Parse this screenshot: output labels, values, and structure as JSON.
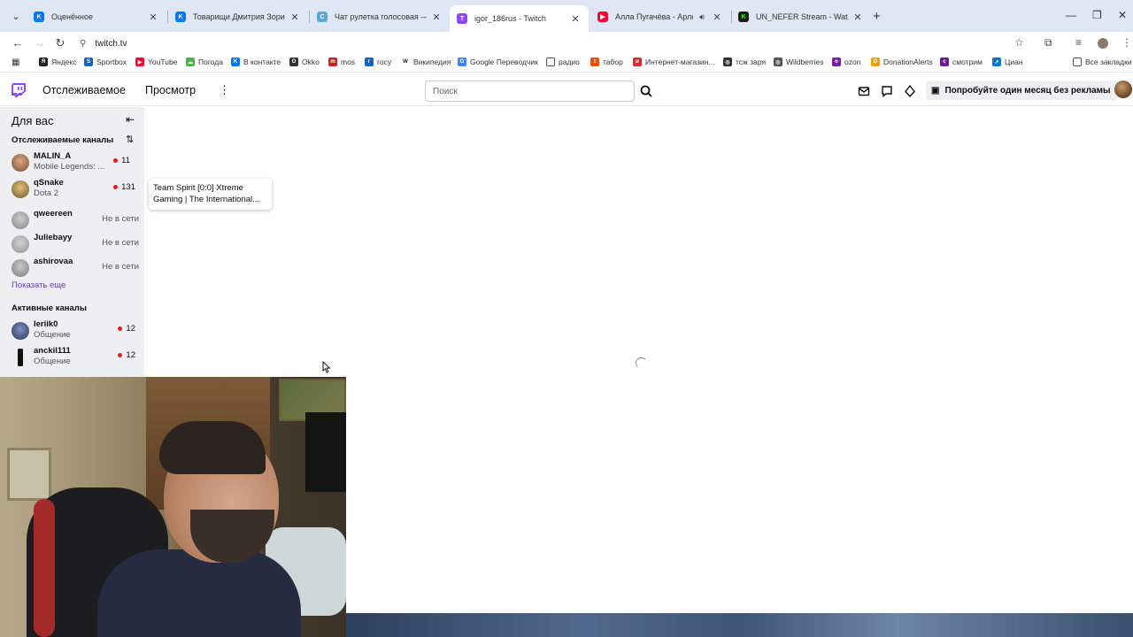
{
  "browser": {
    "tabs": [
      {
        "title": "Оценённое",
        "favicon": "vk",
        "color": "#0077ff"
      },
      {
        "title": "Товарищи Дмитрия Зорина -",
        "favicon": "vk",
        "color": "#0077ff"
      },
      {
        "title": "Чат рулетка голосовая — Nek",
        "favicon": "chat",
        "color": "#5aa9d6"
      },
      {
        "title": "igor_186rus - Twitch",
        "favicon": "twitch",
        "color": "#9146ff",
        "active": true
      },
      {
        "title": "Алла Пугачёва - Арлекино",
        "favicon": "youtube",
        "color": "#ff0033"
      },
      {
        "title": "UN_NEFER Stream - Watch Live",
        "favicon": "kick",
        "color": "#1c1c1c"
      }
    ],
    "url": "twitch.tv",
    "bookmarks": [
      {
        "label": "Яндекс",
        "icon": "yandex-icon",
        "color": "#222"
      },
      {
        "label": "Sportbox",
        "icon": "sportbox-icon",
        "color": "#1565c0"
      },
      {
        "label": "YouTube",
        "icon": "youtube-icon",
        "color": "#ff0033"
      },
      {
        "label": "Погода",
        "icon": "weather-icon",
        "color": "#4caf50"
      },
      {
        "label": "В контакте",
        "icon": "vk-icon",
        "color": "#0077ff"
      },
      {
        "label": "Okko",
        "icon": "okko-icon",
        "color": "#333"
      },
      {
        "label": "mos",
        "icon": "mos-icon",
        "color": "#c62828"
      },
      {
        "label": "госу",
        "icon": "gosu-icon",
        "color": "#1565c0"
      },
      {
        "label": "Википедия",
        "icon": "wikipedia-icon",
        "color": "#222"
      },
      {
        "label": "Google Переводчик",
        "icon": "translate-icon",
        "color": "#4285f4"
      },
      {
        "label": "радио",
        "icon": "folder-icon",
        "color": "#555"
      },
      {
        "label": "табор",
        "icon": "tabor-icon",
        "color": "#e65100"
      },
      {
        "label": "Интернет-магазин...",
        "icon": "shop-icon",
        "color": "#d32f2f"
      },
      {
        "label": "тсж заря",
        "icon": "tsj-icon",
        "color": "#333"
      },
      {
        "label": "Wildberries",
        "icon": "wildberries-icon",
        "color": "#555"
      },
      {
        "label": "ozon",
        "icon": "ozon-icon",
        "color": "#7b1fa2"
      },
      {
        "label": "DonationAlerts",
        "icon": "donation-icon",
        "color": "#f59e0b"
      },
      {
        "label": "смотрим",
        "icon": "smotrim-icon",
        "color": "#6a1b9a"
      },
      {
        "label": "Циан",
        "icon": "cian-icon",
        "color": "#0277bd"
      }
    ],
    "all_bookmarks": "Все закладки"
  },
  "twitch": {
    "nav": {
      "following": "Отслеживаемое",
      "browse": "Просмотр"
    },
    "search_placeholder": "Поиск",
    "promo": "Попробуйте один месяц без рекламы",
    "sidebar": {
      "title": "Для вас",
      "followed_header": "Отслеживаемые каналы",
      "followed": [
        {
          "name": "MALIN_A",
          "game": "Mobile Legends: ...",
          "viewers": "11",
          "live": true,
          "avatar": "#b07a55"
        },
        {
          "name": "qSnake",
          "game": "Dota 2",
          "viewers": "131",
          "live": true,
          "avatar": "#c9a15a"
        },
        {
          "name": "qweereen",
          "status": "Не в сети",
          "live": false,
          "avatar": "#a8a8a8"
        },
        {
          "name": "Juliebayy",
          "status": "Не в сети",
          "live": false,
          "avatar": "#b5b5b5"
        },
        {
          "name": "ashirovaa",
          "status": "Не в сети",
          "live": false,
          "avatar": "#9e9e9e"
        }
      ],
      "show_more": "Показать еще",
      "active_header": "Активные каналы",
      "active": [
        {
          "name": "leriik0",
          "game": "Общение",
          "viewers": "12",
          "live": true,
          "avatar": "#4a5a8a"
        },
        {
          "name": "anckil111",
          "game": "Общение",
          "viewers": "12",
          "live": true,
          "avatar": "#2b2b2b"
        }
      ]
    },
    "tooltip": "Team Spirit [0:0] Xtreme Gaming | The International..."
  }
}
